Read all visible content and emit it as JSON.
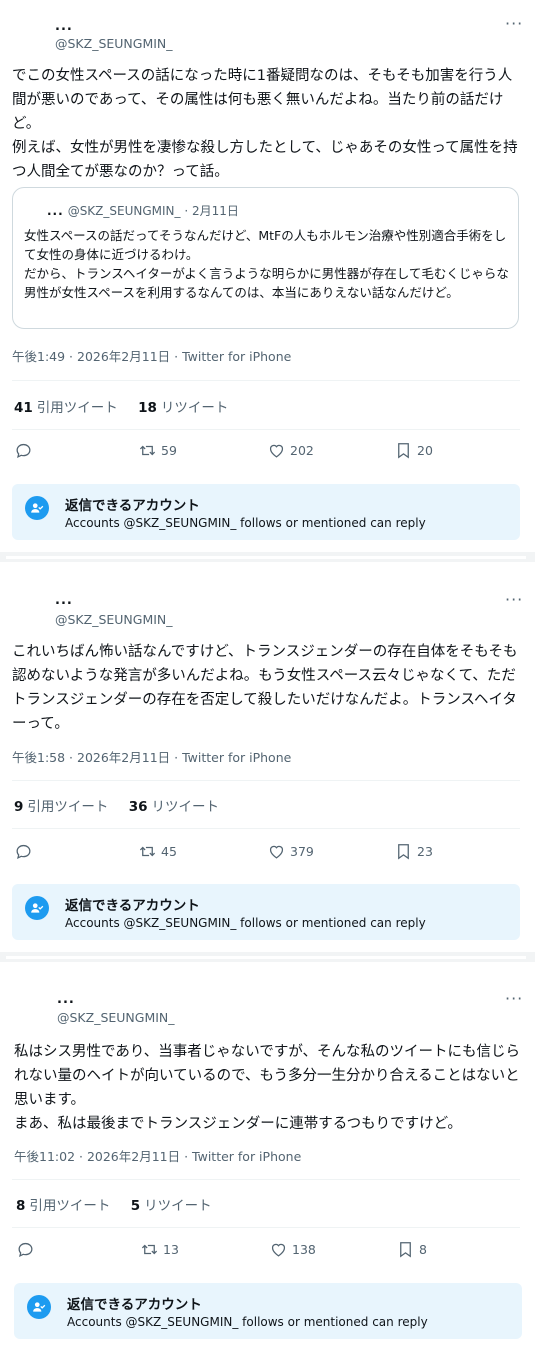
{
  "tweets": [
    {
      "display_name": "...",
      "handle": "@SKZ_SEUNGMIN_",
      "more": "···",
      "text": "でこの女性スペースの話になった時に1番疑問なのは、そもそも加害を行う人間が悪いのであって、その属性は何も悪く無いんだよね。当たり前の話だけど。\n例えば、女性が男性を凄惨な殺し方したとして、じゃあその女性って属性を持つ人間全てが悪なのか？って話。",
      "quote": {
        "display_name": "...",
        "handle_date": "@SKZ_SEUNGMIN_ · 2月11日",
        "text": "女性スペースの話だってそうなんだけど、MtFの人もホルモン治療や性別適合手術をして女性の身体に近づけるわけ。\nだから、トランスヘイターがよく言うような明らかに男性器が存在して毛むくじゃらな男性が女性スペースを利用するなんてのは、本当にありえない話なんだけど。"
      },
      "meta": "午後1:49 · 2026年2月11日 · Twitter for iPhone",
      "quote_count": "41",
      "quote_label": "引用ツイート",
      "retweet_count": "18",
      "retweet_label": "リツイート",
      "actions": {
        "retweets": "59",
        "likes": "202",
        "bookmarks": "20"
      },
      "reply_title": "返信できるアカウント",
      "reply_sub": "Accounts @SKZ_SEUNGMIN_ follows or mentioned can reply"
    },
    {
      "display_name": "...",
      "handle": "@SKZ_SEUNGMIN_",
      "more": "···",
      "text": "これいちばん怖い話なんですけど、トランスジェンダーの存在自体をそもそも認めないような発言が多いんだよね。もう女性スペース云々じゃなくて、ただトランスジェンダーの存在を否定して殺したいだけなんだよ。トランスヘイターって。",
      "meta": "午後1:58 · 2026年2月11日 · Twitter for iPhone",
      "quote_count": "9",
      "quote_label": "引用ツイート",
      "retweet_count": "36",
      "retweet_label": "リツイート",
      "actions": {
        "retweets": "45",
        "likes": "379",
        "bookmarks": "23"
      },
      "reply_title": "返信できるアカウント",
      "reply_sub": "Accounts @SKZ_SEUNGMIN_ follows or mentioned can reply"
    },
    {
      "display_name": "...",
      "handle": "@SKZ_SEUNGMIN_",
      "more": "···",
      "text": "私はシス男性であり、当事者じゃないですが、そんな私のツイートにも信じられない量のヘイトが向いているので、もう多分一生分かり合えることはないと思います。\nまあ、私は最後までトランスジェンダーに連帯するつもりですけど。",
      "meta": "午後11:02 · 2026年2月11日 · Twitter for iPhone",
      "quote_count": "8",
      "quote_label": "引用ツイート",
      "retweet_count": "5",
      "retweet_label": "リツイート",
      "actions": {
        "retweets": "13",
        "likes": "138",
        "bookmarks": "8"
      },
      "reply_title": "返信できるアカウント",
      "reply_sub": "Accounts @SKZ_SEUNGMIN_ follows or mentioned can reply"
    }
  ],
  "colors": {
    "accent": "#1d9bf0",
    "muted": "#536471",
    "reply_bg": "#e8f5fd"
  },
  "icons": [
    "reply-icon",
    "retweet-icon",
    "like-icon",
    "bookmark-icon",
    "people-check-icon",
    "more-icon"
  ]
}
